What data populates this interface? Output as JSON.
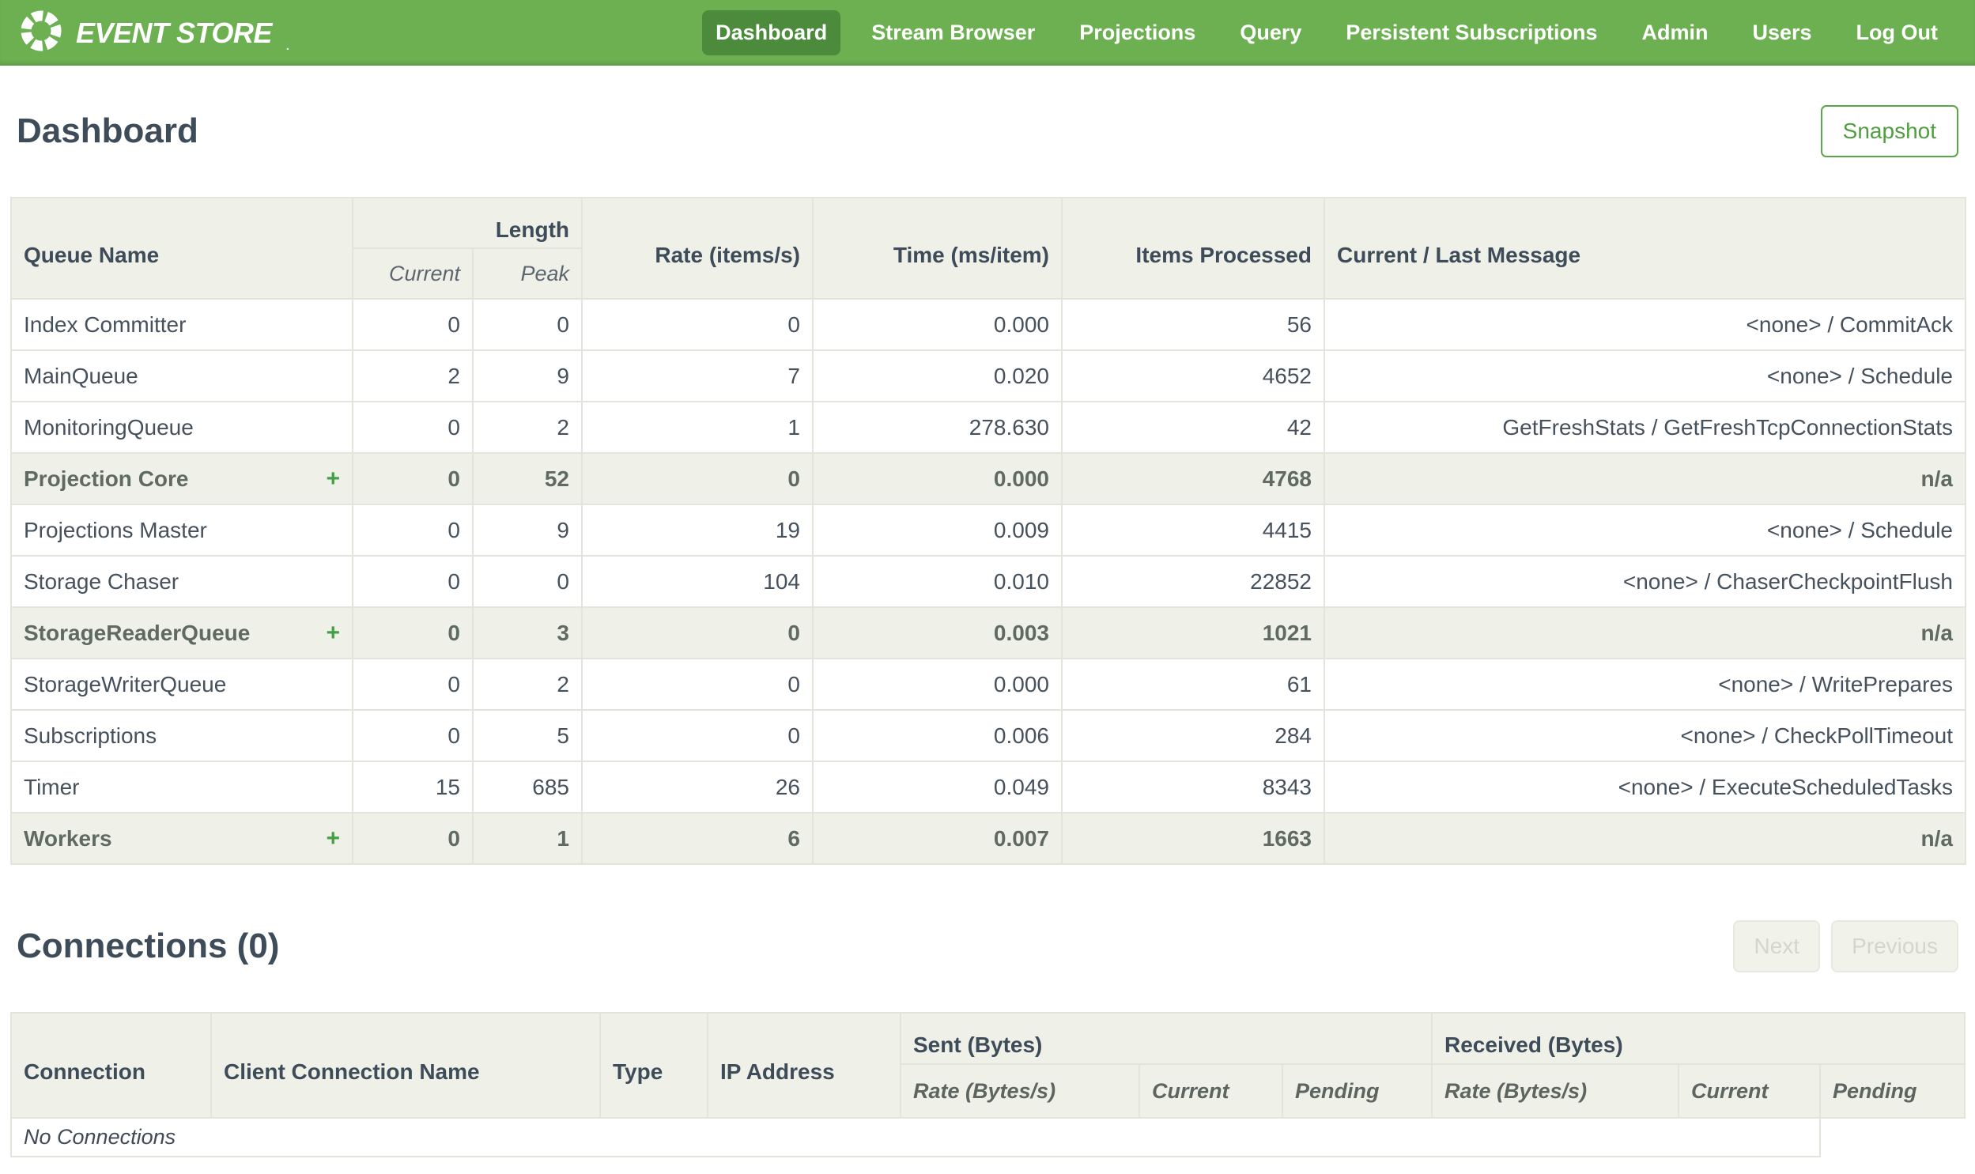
{
  "colors": {
    "nav_green": "#6cb052",
    "nav_active_green": "#4c8b3c",
    "accent_green": "#4f9e3e",
    "header_bg": "#eff1e9",
    "text_dark": "#3e4b59"
  },
  "nav": {
    "brand": "EVENT STORE",
    "brand_mark": ".",
    "items": [
      {
        "label": "Dashboard",
        "active": true
      },
      {
        "label": "Stream Browser",
        "active": false
      },
      {
        "label": "Projections",
        "active": false
      },
      {
        "label": "Query",
        "active": false
      },
      {
        "label": "Persistent Subscriptions",
        "active": false
      },
      {
        "label": "Admin",
        "active": false
      },
      {
        "label": "Users",
        "active": false
      },
      {
        "label": "Log Out",
        "active": false
      }
    ]
  },
  "page": {
    "title": "Dashboard",
    "snapshot_label": "Snapshot"
  },
  "queues": {
    "expand_label": "+",
    "headers": {
      "queue_name": "Queue Name",
      "length": "Length",
      "current": "Current",
      "peak": "Peak",
      "rate": "Rate (items/s)",
      "time": "Time (ms/item)",
      "items_processed": "Items Processed",
      "message": "Current / Last Message"
    },
    "rows": [
      {
        "name": "Index Committer",
        "current": "0",
        "peak": "0",
        "rate": "0",
        "time": "0.000",
        "items": "56",
        "message": "<none> / CommitAck"
      },
      {
        "name": "MainQueue",
        "current": "2",
        "peak": "9",
        "rate": "7",
        "time": "0.020",
        "items": "4652",
        "message": "<none> / Schedule"
      },
      {
        "name": "MonitoringQueue",
        "current": "0",
        "peak": "2",
        "rate": "1",
        "time": "278.630",
        "items": "42",
        "message": "GetFreshStats / GetFreshTcpConnectionStats"
      },
      {
        "name": "Projection Core",
        "current": "0",
        "peak": "52",
        "rate": "0",
        "time": "0.000",
        "items": "4768",
        "message": "n/a",
        "group": true
      },
      {
        "name": "Projections Master",
        "current": "0",
        "peak": "9",
        "rate": "19",
        "time": "0.009",
        "items": "4415",
        "message": "<none> / Schedule"
      },
      {
        "name": "Storage Chaser",
        "current": "0",
        "peak": "0",
        "rate": "104",
        "time": "0.010",
        "items": "22852",
        "message": "<none> / ChaserCheckpointFlush"
      },
      {
        "name": "StorageReaderQueue",
        "current": "0",
        "peak": "3",
        "rate": "0",
        "time": "0.003",
        "items": "1021",
        "message": "n/a",
        "group": true
      },
      {
        "name": "StorageWriterQueue",
        "current": "0",
        "peak": "2",
        "rate": "0",
        "time": "0.000",
        "items": "61",
        "message": "<none> / WritePrepares"
      },
      {
        "name": "Subscriptions",
        "current": "0",
        "peak": "5",
        "rate": "0",
        "time": "0.006",
        "items": "284",
        "message": "<none> / CheckPollTimeout"
      },
      {
        "name": "Timer",
        "current": "15",
        "peak": "685",
        "rate": "26",
        "time": "0.049",
        "items": "8343",
        "message": "<none> / ExecuteScheduledTasks"
      },
      {
        "name": "Workers",
        "current": "0",
        "peak": "1",
        "rate": "6",
        "time": "0.007",
        "items": "1663",
        "message": "n/a",
        "group": true
      }
    ]
  },
  "connections": {
    "title": "Connections (0)",
    "next_label": "Next",
    "previous_label": "Previous",
    "headers": {
      "connection": "Connection",
      "client_name": "Client Connection Name",
      "type": "Type",
      "ip": "IP Address",
      "sent": "Sent (Bytes)",
      "received": "Received (Bytes)",
      "rate": "Rate (Bytes/s)",
      "current": "Current",
      "pending": "Pending"
    },
    "empty_message": "No Connections"
  }
}
